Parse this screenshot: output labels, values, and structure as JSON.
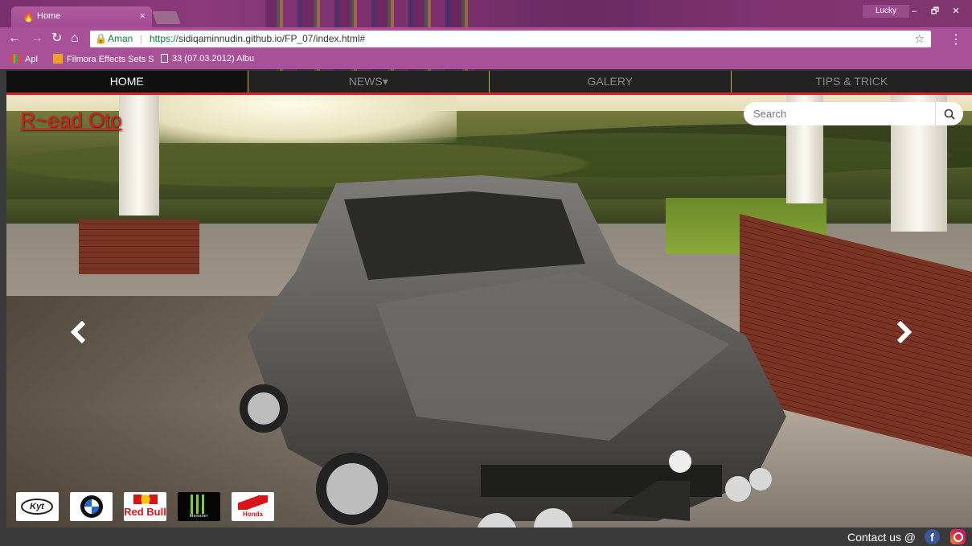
{
  "browser": {
    "tab_title": "Home",
    "tab_close": "×",
    "user_label": "Lucky",
    "window_buttons": [
      "–",
      "🗗",
      "✕"
    ],
    "secure_label": "Aman",
    "url_scheme": "https://",
    "url_rest": "sidiqaminnudin.github.io/FP_07/index.html#",
    "bookmarks": [
      "Apl",
      "Filmora Effects Sets S",
      "33 (07.03.2012) Albu"
    ]
  },
  "nav": {
    "items": [
      "HOME",
      "NEWS▾",
      "GALERY",
      "TIPS & TRICK"
    ]
  },
  "hero": {
    "brand": "R~ead Oto",
    "search_placeholder": "Search",
    "sponsors": [
      "Kyt",
      "BMW",
      "Red Bull",
      "Monster",
      "Honda"
    ]
  },
  "footer": {
    "contact_text": "Contact us @"
  },
  "colors": {
    "nav_accent_red": "#d42020",
    "nav_divider_gold": "#c8b428",
    "brand_red": "#d91c1c",
    "chrome_purple": "#a95198"
  },
  "icons": [
    "flame-favicon",
    "back-arrow-icon",
    "forward-arrow-icon",
    "reload-icon",
    "home-icon",
    "lock-icon",
    "star-icon",
    "kebab-menu-icon",
    "apps-grid-icon",
    "search-icon",
    "chevron-left-icon",
    "chevron-right-icon",
    "facebook-icon",
    "instagram-icon"
  ]
}
